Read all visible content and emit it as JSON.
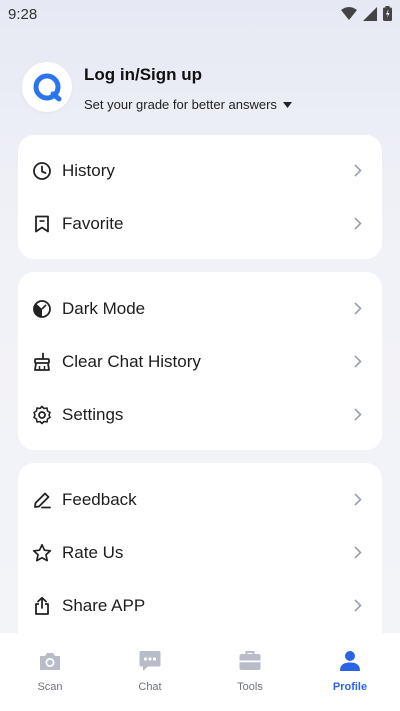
{
  "status_bar": {
    "time": "9:28"
  },
  "profile": {
    "login_label": "Log in/Sign up",
    "grade_prompt": "Set your grade for better answers"
  },
  "menu": {
    "group1": [
      {
        "label": "History",
        "icon": "clock-icon"
      },
      {
        "label": "Favorite",
        "icon": "bookmark-icon"
      }
    ],
    "group2": [
      {
        "label": "Dark Mode",
        "icon": "dark-mode-icon"
      },
      {
        "label": "Clear Chat History",
        "icon": "broom-icon"
      },
      {
        "label": "Settings",
        "icon": "gear-icon"
      }
    ],
    "group3": [
      {
        "label": "Feedback",
        "icon": "pencil-icon"
      },
      {
        "label": "Rate Us",
        "icon": "star-icon"
      },
      {
        "label": "Share APP",
        "icon": "share-icon"
      }
    ]
  },
  "tabs": [
    {
      "label": "Scan",
      "icon": "camera-icon",
      "active": false
    },
    {
      "label": "Chat",
      "icon": "chat-icon",
      "active": false
    },
    {
      "label": "Tools",
      "icon": "toolbox-icon",
      "active": false
    },
    {
      "label": "Profile",
      "icon": "person-icon",
      "active": true
    }
  ],
  "colors": {
    "accent": "#2b63e8",
    "inactive_tab": "#b7bcc8",
    "text": "#1d1d1d"
  }
}
